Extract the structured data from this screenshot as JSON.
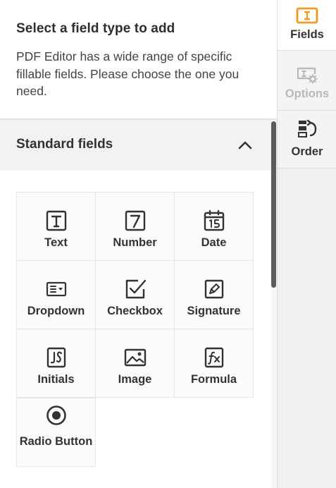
{
  "header": {
    "title": "Select a field type to add",
    "description": "PDF Editor has a wide range of specific fillable fields. Please choose the one you need."
  },
  "section": {
    "title": "Standard fields",
    "toggle_icon": "chevron-up-icon"
  },
  "fields": [
    {
      "label": "Text",
      "icon": "text-field-icon"
    },
    {
      "label": "Number",
      "icon": "number-field-icon"
    },
    {
      "label": "Date",
      "icon": "calendar-icon"
    },
    {
      "label": "Dropdown",
      "icon": "dropdown-icon"
    },
    {
      "label": "Checkbox",
      "icon": "checkbox-icon"
    },
    {
      "label": "Signature",
      "icon": "signature-icon"
    },
    {
      "label": "Initials",
      "icon": "initials-icon"
    },
    {
      "label": "Image",
      "icon": "image-icon"
    },
    {
      "label": "Formula",
      "icon": "formula-icon"
    },
    {
      "label": "Radio Button",
      "icon": "radio-button-icon"
    }
  ],
  "rail": {
    "tabs": [
      {
        "label": "Fields",
        "icon": "text-cursor-icon",
        "active": true
      },
      {
        "label": "Options",
        "icon": "field-settings-icon",
        "enabled": false
      },
      {
        "label": "Order",
        "icon": "reorder-icon"
      }
    ]
  },
  "colors": {
    "accent": "#f29b1d",
    "text": "#333333",
    "disabled": "#b8b8b8",
    "section_bg": "#f2f2f2",
    "scroll_thumb": "#5c5c5c"
  }
}
